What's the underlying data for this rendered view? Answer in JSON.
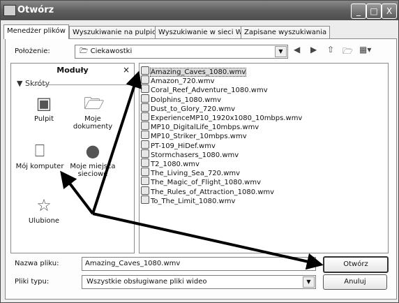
{
  "window": {
    "title": "Otwórz",
    "controls": {
      "minimize": "_",
      "maximize": "□",
      "close": "X"
    }
  },
  "tabs": [
    "Menedżer plików",
    "Wyszukiwanie na pulpicie",
    "Wyszukiwanie w sieci Web",
    "Zapisane wyszukiwania"
  ],
  "location": {
    "label": "Położenie:",
    "value": "Ciekawostki"
  },
  "toolbar_icons": [
    "back-icon",
    "forward-icon",
    "up-folder-icon",
    "new-folder-icon",
    "view-menu-icon"
  ],
  "places": {
    "header": "Moduły",
    "close": "×",
    "section": "Skróty",
    "items": [
      {
        "label": "Pulpit",
        "icon": "desktop-icon"
      },
      {
        "label": "Moje dokumenty",
        "icon": "documents-icon"
      },
      {
        "label": "Mój komputer",
        "icon": "computer-icon"
      },
      {
        "label": "Moje miejsca sieciowe",
        "icon": "network-icon"
      },
      {
        "label": "Ulubione",
        "icon": "star-icon"
      }
    ]
  },
  "files": [
    "Amazing_Caves_1080.wmv",
    "Amazon_720.wmv",
    "Coral_Reef_Adventure_1080.wmv",
    "Dolphins_1080.wmv",
    "Dust_to_Glory_720.wmv",
    "ExperienceMP10_1920x1080_10mbps.wmv",
    "MP10_DigitalLife_10mbps.wmv",
    "MP10_Striker_10mbps.wmv",
    "PT-109_HiDef.wmv",
    "Stormchasers_1080.wmv",
    "T2_1080.wmv",
    "The_Living_Sea_720.wmv",
    "The_Magic_of_Flight_1080.wmv",
    "The_Rules_of_Attraction_1080.wmv",
    "To_The_Limit_1080.wmv"
  ],
  "selected_file_index": 0,
  "filename": {
    "label": "Nazwa pliku:",
    "value": "Amazing_Caves_1080.wmv"
  },
  "filetype": {
    "label": "Pliki typu:",
    "value": "Wszystkie obsługiwane pliki wideo"
  },
  "buttons": {
    "open": "Otwórz",
    "cancel": "Anuluj"
  }
}
